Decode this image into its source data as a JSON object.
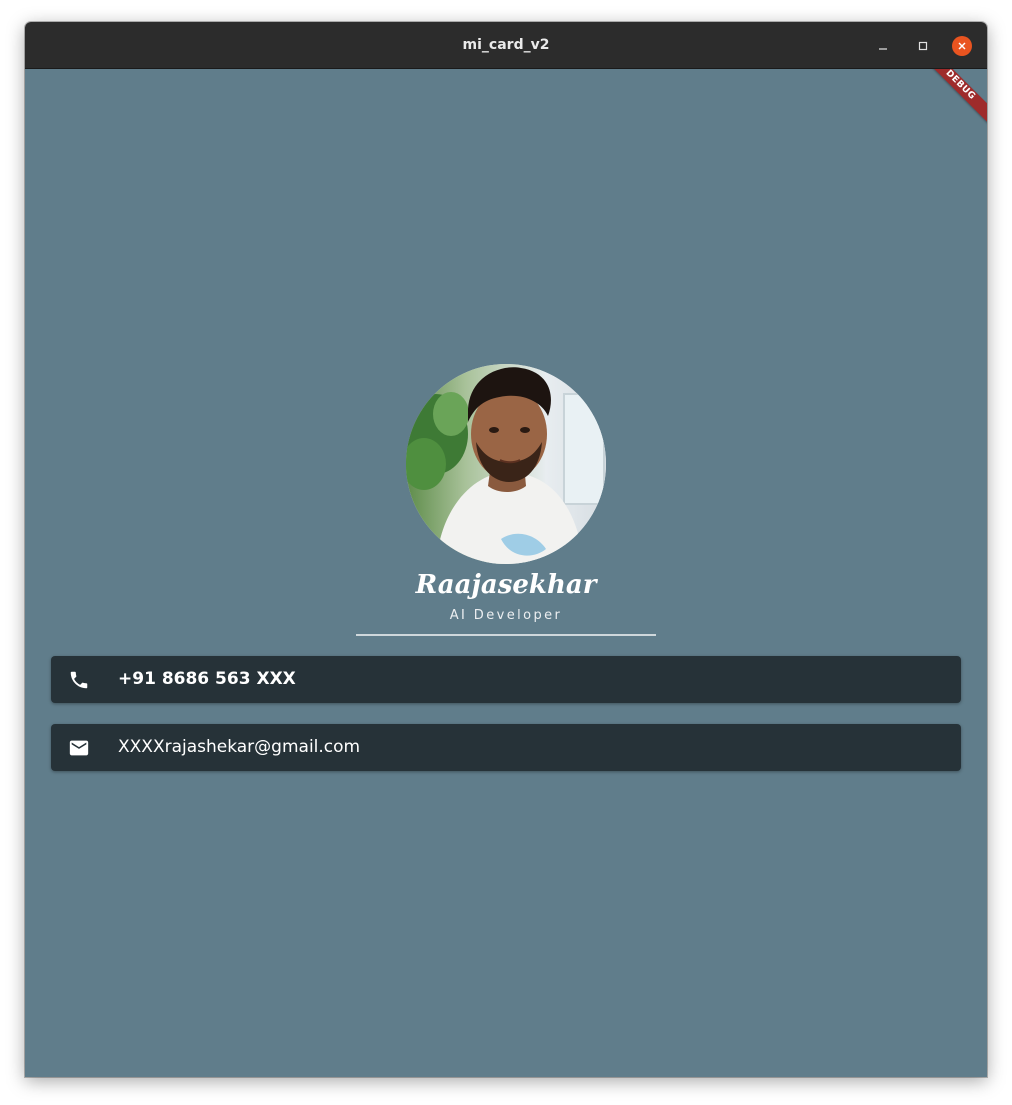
{
  "window": {
    "title": "mi_card_v2",
    "minimize_icon": "minimize-icon",
    "maximize_icon": "maximize-icon",
    "close_icon": "close-icon",
    "close_color": "#e95420"
  },
  "app": {
    "background_color": "#607d8b",
    "card_color": "#263238",
    "debug_banner": "DEBUG"
  },
  "profile": {
    "avatar_icon": "profile-photo",
    "name": "Raajasekhar",
    "role": "AI Developer"
  },
  "contacts": {
    "phone": {
      "icon": "phone-icon",
      "value": "+91 8686 563 XXX"
    },
    "email": {
      "icon": "mail-icon",
      "value": "XXXXrajashekar@gmail.com"
    }
  }
}
